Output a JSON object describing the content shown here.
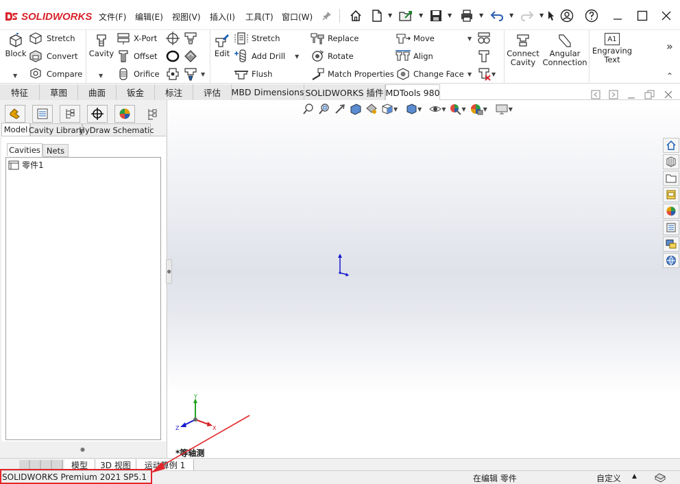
{
  "app": {
    "name": "SOLIDWORKS"
  },
  "menus": [
    "文件(F)",
    "编辑(E)",
    "视图(V)",
    "插入(I)",
    "工具(T)",
    "窗口(W)"
  ],
  "quick_access_icons": [
    "pin-icon",
    "home-icon",
    "new-document-icon",
    "open-file-icon",
    "save-icon",
    "print-icon",
    "undo-icon",
    "redo-icon",
    "select-icon",
    "user-account-icon",
    "help-icon"
  ],
  "ribbon": {
    "block": {
      "label": "Block"
    },
    "stretch1": {
      "label": "Stretch"
    },
    "convert": {
      "label": "Convert"
    },
    "compare": {
      "label": "Compare"
    },
    "cavity": {
      "label": "Cavity"
    },
    "xport": {
      "label": "X-Port"
    },
    "offset": {
      "label": "Offset"
    },
    "orifice": {
      "label": "Orifice"
    },
    "edit": {
      "label": "Edit"
    },
    "stretch2": {
      "label": "Stretch"
    },
    "add_drill": {
      "label": "Add Drill"
    },
    "flush": {
      "label": "Flush"
    },
    "replace": {
      "label": "Replace"
    },
    "rotate": {
      "label": "Rotate"
    },
    "match_properties": {
      "label": "Match Properties"
    },
    "move": {
      "label": "Move"
    },
    "align": {
      "label": "Align"
    },
    "change_face": {
      "label": "Change Face"
    },
    "connect_cavity": {
      "line1": "Connect",
      "line2": "Cavity"
    },
    "angular_connection": {
      "line1": "Angular",
      "line2": "Connection"
    },
    "engraving_text": {
      "line1": "Engraving",
      "line2": "Text",
      "icon_text": "A1"
    },
    "more": "»"
  },
  "command_tabs": [
    {
      "label": "特征",
      "active": false
    },
    {
      "label": "草图",
      "active": false
    },
    {
      "label": "曲面",
      "active": false
    },
    {
      "label": "钣金",
      "active": false
    },
    {
      "label": "标注",
      "active": false
    },
    {
      "label": "评估",
      "active": false
    },
    {
      "label": "MBD Dimensions",
      "active": false
    },
    {
      "label": "SOLIDWORKS 插件",
      "active": false
    },
    {
      "label": "MDTools 980",
      "active": true
    }
  ],
  "panel": {
    "tabs": [
      "Model",
      "Cavity Library",
      "HyDraw Schematic"
    ],
    "subtabs": [
      "Cavities",
      "Nets"
    ],
    "tree_items": [
      {
        "label": "零件1"
      }
    ]
  },
  "viewport": {
    "view_label": "*等轴测",
    "axis_x": "X",
    "axis_y": "Y",
    "axis_z": "Z"
  },
  "bottom_tabs": [
    "模型",
    "3D 视图",
    "运动算例 1"
  ],
  "statusbar": {
    "product": "SOLIDWORKS Premium 2021 SP5.1",
    "mode": "在编辑 零件",
    "custom": "自定义"
  },
  "colors": {
    "brand_red": "#d8232a",
    "accent_blue": "#1a5fb4",
    "annotation_red": "#e3262b"
  }
}
